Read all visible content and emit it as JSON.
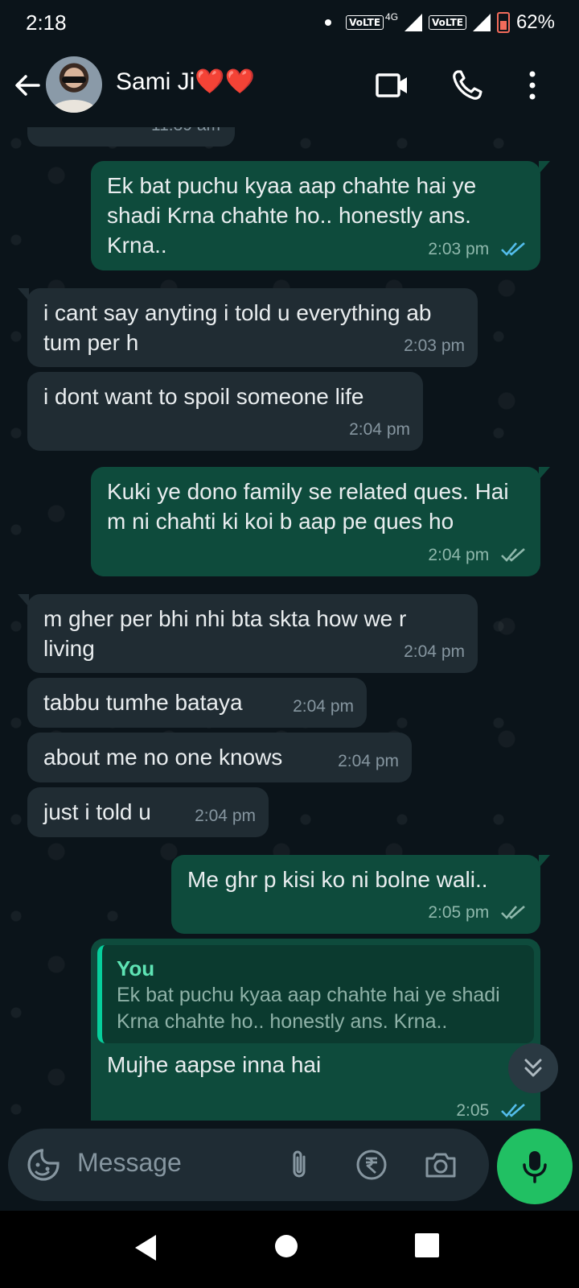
{
  "status": {
    "time": "2:18",
    "volte1": "VoLTE",
    "net": "4G",
    "volte2": "VoLTE",
    "battery": "62%"
  },
  "header": {
    "contact_name": "Sami Ji❤️❤️"
  },
  "messages": [
    {
      "text": "11:39 am"
    },
    {
      "text": "Ek bat puchu kyaa aap chahte hai ye shadi Krna chahte ho.. honestly ans. Krna..",
      "time": "2:03 pm"
    },
    {
      "text": "i cant say anyting i told u everything ab tum per h",
      "time": "2:03 pm"
    },
    {
      "text": "i dont want to spoil someone life",
      "time": "2:04 pm"
    },
    {
      "text": "Kuki ye dono family se related ques. Hai m ni chahti ki koi b aap pe ques ho",
      "time": "2:04 pm"
    },
    {
      "text": "m gher per bhi nhi bta skta how we r living",
      "time": "2:04 pm"
    },
    {
      "text": "tabbu tumhe bataya",
      "time": "2:04 pm"
    },
    {
      "text": "about me no one knows",
      "time": "2:04 pm"
    },
    {
      "text": "just i told u",
      "time": "2:04 pm"
    },
    {
      "text": "Me ghr p kisi ko ni bolne wali..",
      "time": "2:05 pm"
    },
    {
      "quote_name": "You",
      "quote_text": "Ek bat puchu kyaa aap chahte hai ye shadi Krna chahte ho.. honestly ans. Krna..",
      "text": "Mujhe aapse inna hai",
      "time": "2:05"
    }
  ],
  "input": {
    "placeholder": "Message"
  },
  "colors": {
    "accent": "#21c063",
    "read_tick": "#53bdeb",
    "outgoing": "#0e4b3c",
    "incoming": "#202c33"
  }
}
